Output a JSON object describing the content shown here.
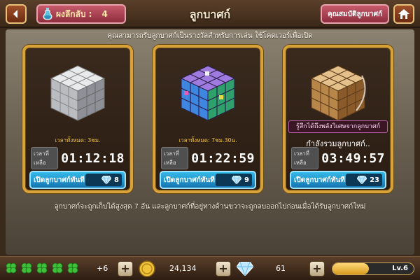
{
  "header": {
    "back_icon": "back-arrow-icon",
    "counter_icon": "potion-icon",
    "counter_label": "ผงลึกลับ :",
    "counter_value": "4",
    "title": "ลูกบาศก์",
    "props_button": "คุณสมบัติลูกบาศก์",
    "home_icon": "home-icon"
  },
  "info_text": "คุณสามารถรับลูกบาศก์เป็นรางวัลสำหรับการเล่น ใช้โคดเวอร์เพื่อเปิด",
  "cards": [
    {
      "art_icon": "silver-cube-icon",
      "status": "เวลาทั้งหมด: 3ชม.",
      "timer_label": "เวลาที่เหลือ",
      "timer": "01:12:18",
      "open_label": "เปิดลูกบาศก์ทันที",
      "cost_icon": "diamond-icon",
      "cost": "8"
    },
    {
      "art_icon": "crystal-cube-icon",
      "status": "เวลาทั้งหมด: 7ชม.30น.",
      "timer_label": "เวลาที่เหลือ",
      "timer": "01:22:59",
      "open_label": "เปิดลูกบาศก์ทันที",
      "cost_icon": "diamond-icon",
      "cost": "9"
    },
    {
      "art_icon": "golden-cube-icon",
      "promo": "รู้สึกได้ถึงพลังวิเศษจากลูกบาศก์",
      "opening": "กำลังรวมลูกบาศก์..",
      "timer_label": "เวลาที่เหลือ",
      "timer": "03:49:57",
      "open_label": "เปิดลูกบาศก์ทันที",
      "cost_icon": "diamond-icon",
      "cost": "23"
    }
  ],
  "footer_note": "ลูกบาศก์จะถูกเก็บได้สูงสุด 7 อัน และลูกบาศก์ที่อยู่ทางด้านขวาจะถูกลบออกไปก่อนเมื่อได้รับลูกบาศก์ใหม่",
  "bottom": {
    "clover_icon": "clover-icon",
    "clover_count": 5,
    "clover_extra": "+6",
    "coin_icon": "coin-icon",
    "coins": "24,134",
    "diamond_icon": "diamond-icon",
    "diamonds": "61",
    "plus": "+",
    "level": "Lv.6",
    "level_progress": 0.45
  },
  "colors": {
    "card_border": "#d8a23a",
    "button_blue": "#1e8fd0",
    "status_gold": "#f1c23b",
    "promo_magenta": "#b45fa3"
  }
}
